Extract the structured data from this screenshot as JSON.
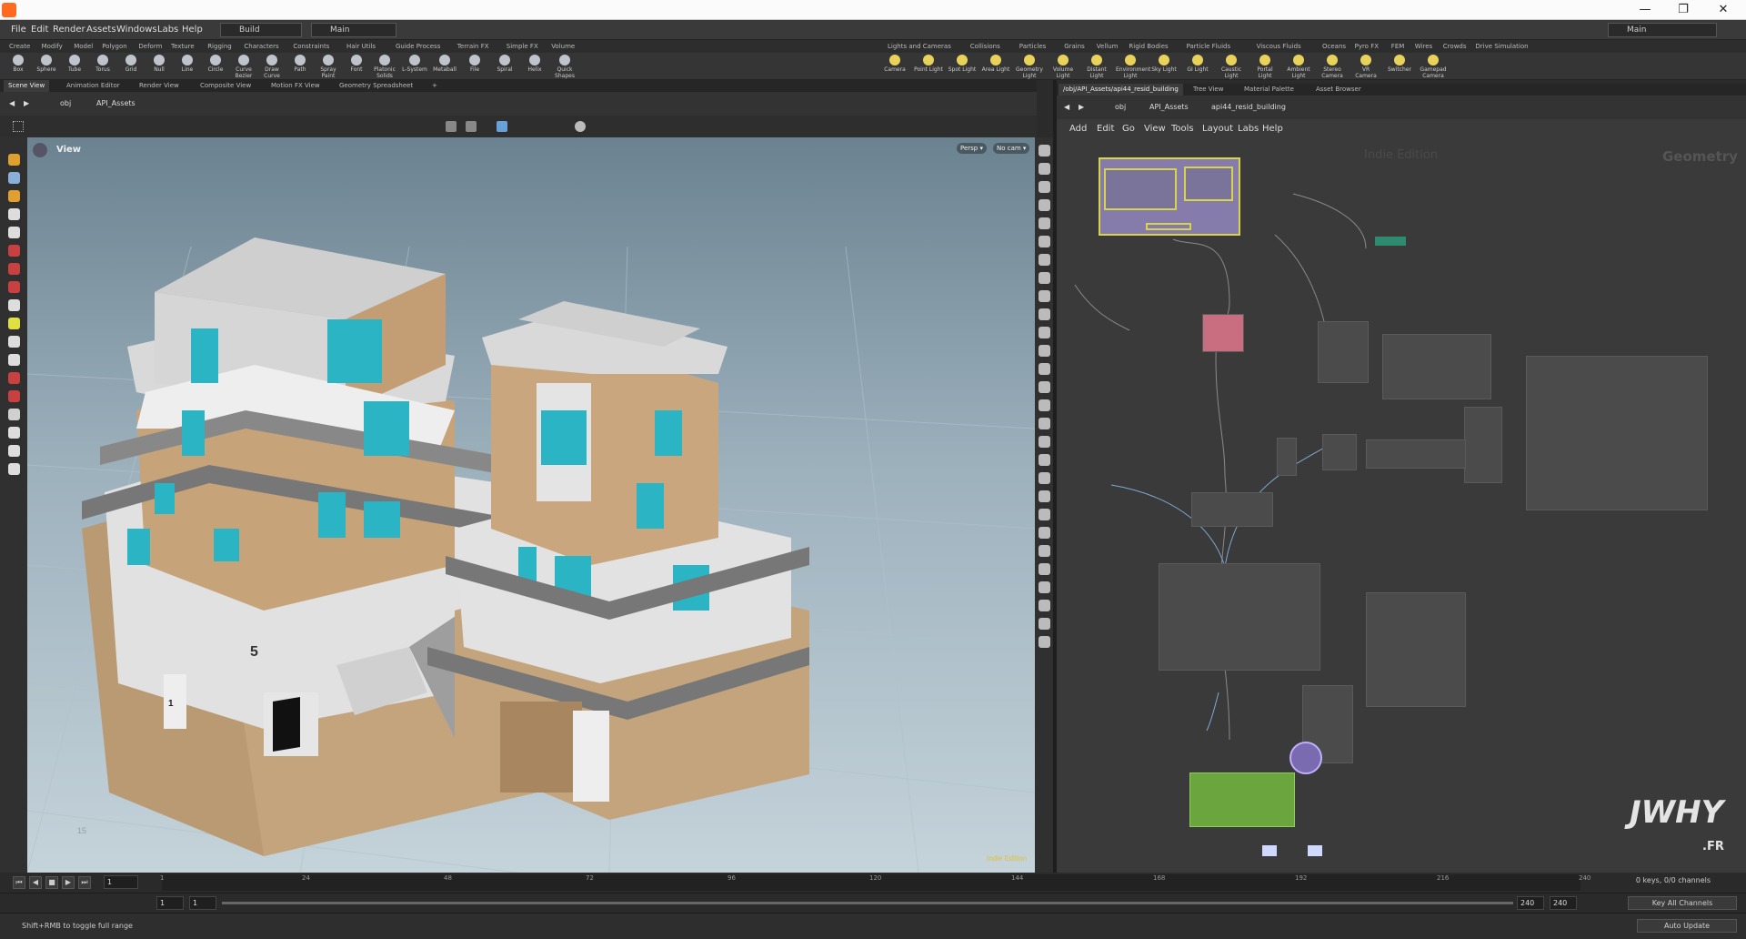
{
  "window": {
    "min": "—",
    "max": "❐",
    "close": "✕"
  },
  "menu": {
    "items": [
      "File",
      "Edit",
      "Render",
      "Assets",
      "Windows",
      "Labs",
      "Help"
    ],
    "desktop": "Build",
    "context": "Main",
    "right_desktop": "Main"
  },
  "shelf_left": {
    "tabs": [
      "Create",
      "Modify",
      "Model",
      "Polygon",
      "Deform",
      "Texture",
      "Rigging",
      "Characters",
      "Constraints",
      "Hair Utils",
      "Guide Process",
      "Terrain FX",
      "Simple FX",
      "Volume"
    ],
    "tools": [
      "Box",
      "Sphere",
      "Tube",
      "Torus",
      "Grid",
      "Null",
      "Line",
      "Circle",
      "Curve Bezier",
      "Draw Curve",
      "Path",
      "Spray Paint",
      "Font",
      "Platonic Solids",
      "L-System",
      "Metaball",
      "File",
      "Spiral",
      "Helix",
      "Quick Shapes"
    ]
  },
  "shelf_right": {
    "tabs": [
      "Lights and Cameras",
      "Collisions",
      "Particles",
      "Grains",
      "Vellum",
      "Rigid Bodies",
      "Particle Fluids",
      "Viscous Fluids",
      "Oceans",
      "Pyro FX",
      "FEM",
      "Wires",
      "Crowds",
      "Drive Simulation"
    ],
    "tools": [
      "Camera",
      "Point Light",
      "Spot Light",
      "Area Light",
      "Geometry Light",
      "Volume Light",
      "Distant Light",
      "Environment Light",
      "Sky Light",
      "GI Light",
      "Caustic Light",
      "Portal Light",
      "Ambient Light",
      "Stereo Camera",
      "VR Camera",
      "Switcher",
      "Gamepad Camera"
    ]
  },
  "left_pane": {
    "tabs": [
      "Scene View",
      "Animation Editor",
      "Render View",
      "Composite View",
      "Motion FX View",
      "Geometry Spreadsheet"
    ],
    "path": [
      "obj",
      "API_Assets"
    ]
  },
  "right_pane": {
    "tabs": [
      "/obj/API_Assets/api44_resid_building",
      "Tree View",
      "Material Palette",
      "Asset Browser"
    ],
    "path": [
      "obj",
      "API_Assets",
      "api44_resid_building"
    ],
    "menu": [
      "Add",
      "Edit",
      "Go",
      "View",
      "Tools",
      "Layout",
      "Labs",
      "Help"
    ],
    "watermark": "Indie Edition",
    "context_label": "Geometry"
  },
  "viewport": {
    "label": "View",
    "persp": "Persp ▾",
    "cam": "No cam ▾",
    "building_number": "5",
    "door_number": "1",
    "edition": "Indie Edition",
    "grid_label": "15"
  },
  "timeline": {
    "ticks": [
      "1",
      "24",
      "48",
      "72",
      "96",
      "120",
      "144",
      "168",
      "192",
      "216",
      "240"
    ],
    "frame": "1",
    "start": "1",
    "start2": "1",
    "end": "240",
    "end2": "240",
    "keys": "0 keys, 0/0 channels",
    "key_all": "Key All Channels"
  },
  "status": {
    "hint": "Shift+RMB to toggle full range",
    "auto_update": "Auto Update"
  },
  "logo": {
    "text": "JWHY",
    "sub": ".FR"
  }
}
